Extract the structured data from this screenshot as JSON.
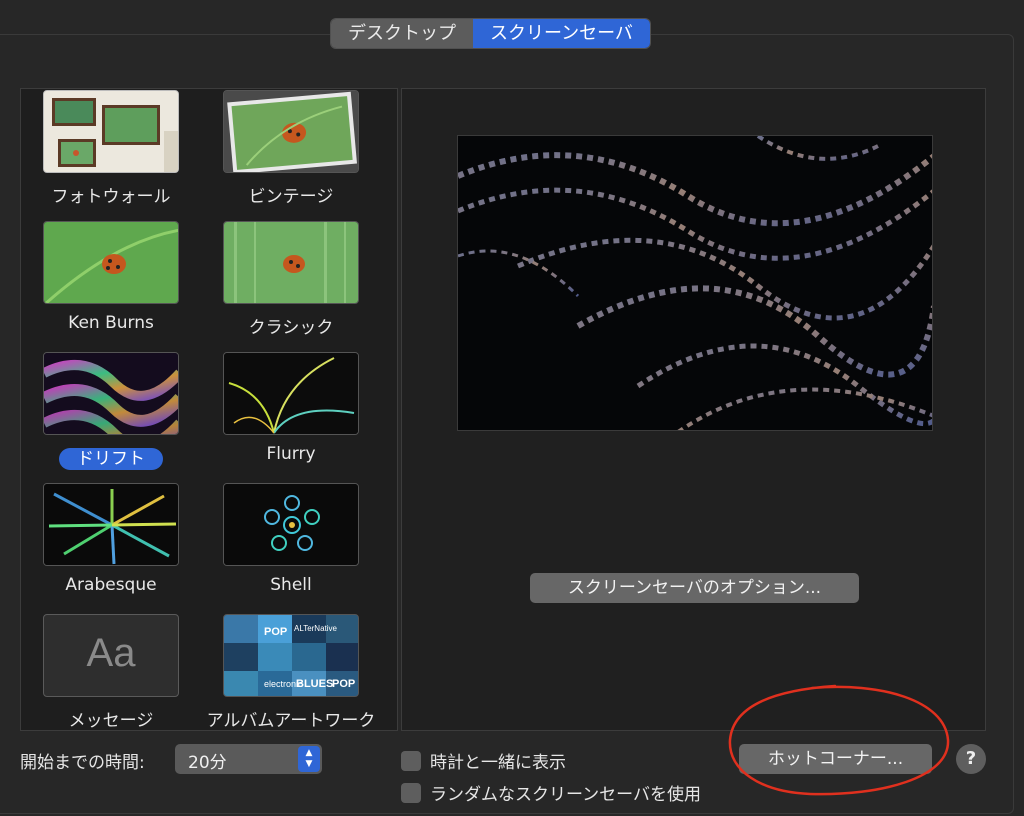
{
  "tabs": [
    {
      "label": "デスクトップ",
      "active": false
    },
    {
      "label": "スクリーンセーバ",
      "active": true
    }
  ],
  "screensavers": [
    {
      "label": "フォトウォール",
      "icon": "photo-wall-thumb"
    },
    {
      "label": "ビンテージ",
      "icon": "vintage-thumb"
    },
    {
      "label": "Ken Burns",
      "icon": "ken-burns-thumb"
    },
    {
      "label": "クラシック",
      "icon": "classic-thumb"
    },
    {
      "label": "ドリフト",
      "icon": "drift-thumb",
      "selected": true
    },
    {
      "label": "Flurry",
      "icon": "flurry-thumb"
    },
    {
      "label": "Arabesque",
      "icon": "arabesque-thumb"
    },
    {
      "label": "Shell",
      "icon": "shell-thumb"
    },
    {
      "label": "メッセージ",
      "icon": "message-thumb",
      "thumb_text": "Aa"
    },
    {
      "label": "アルバムアートワーク",
      "icon": "album-artwork-thumb",
      "thumb_words": [
        "POP",
        "ALTerNative",
        "electronic",
        "BLUES",
        "POP"
      ]
    }
  ],
  "preview": {
    "options_button": "スクリーンセーバのオプション..."
  },
  "bottom": {
    "start_label": "開始までの時間:",
    "start_value": "20分",
    "show_clock_label": "時計と一緒に表示",
    "random_label": "ランダムなスクリーンセーバを使用",
    "hot_corners_button": "ホットコーナー...",
    "help_label": "?"
  },
  "colors": {
    "accent": "#2f66d6",
    "annotation": "#e0301e",
    "background": "#272727"
  }
}
